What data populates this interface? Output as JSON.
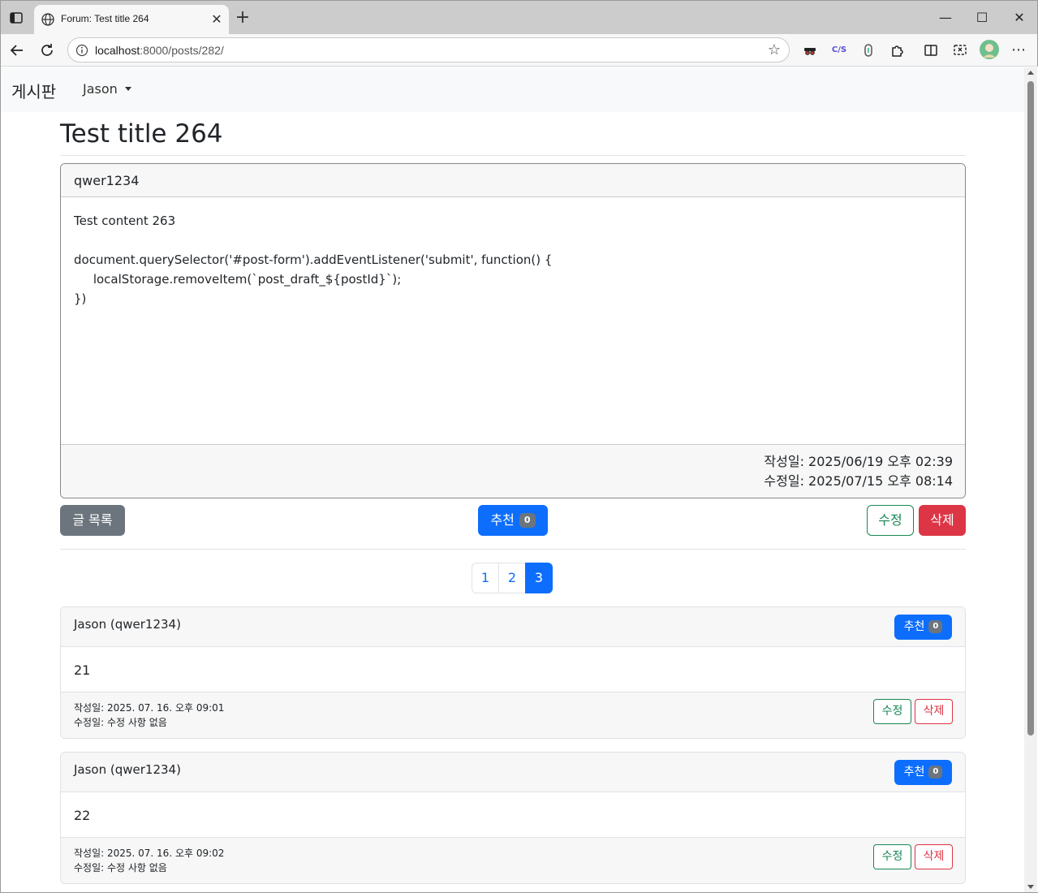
{
  "browser": {
    "tab_title": "Forum: Test title 264",
    "address_host": "localhost",
    "address_path": ":8000/posts/282/",
    "window_controls": {
      "minimize": "—",
      "maximize": "☐",
      "close": "✕"
    }
  },
  "nav": {
    "brand": "게시판",
    "user": "Jason"
  },
  "post": {
    "title": "Test title 264",
    "author": "qwer1234",
    "content": "Test content 263\n\ndocument.querySelector('#post-form').addEventListener('submit', function() {\n     localStorage.removeItem(`post_draft_${postId}`);\n})",
    "created": "작성일: 2025/06/19 오후 02:39",
    "updated": "수정일: 2025/07/15 오후 08:14"
  },
  "actions": {
    "list_label": "글 목록",
    "recommend_label": "추천",
    "recommend_count": "0",
    "edit_label": "수정",
    "delete_label": "삭제"
  },
  "pagination": {
    "pages": [
      "1",
      "2",
      "3"
    ],
    "current": "3"
  },
  "comments": [
    {
      "author": "Jason (qwer1234)",
      "recommend_label": "추천",
      "recommend_count": "0",
      "body": "21",
      "created": "작성일: 2025. 07. 16. 오후 09:01",
      "updated": "수정일: 수정 사항 없음",
      "edit_label": "수정",
      "delete_label": "삭제"
    },
    {
      "author": "Jason (qwer1234)",
      "recommend_label": "추천",
      "recommend_count": "0",
      "body": "22",
      "created": "작성일: 2025. 07. 16. 오후 09:02",
      "updated": "수정일: 수정 사항 없음",
      "edit_label": "수정",
      "delete_label": "삭제"
    }
  ],
  "colors": {
    "primary": "#0d6efd",
    "secondary": "#6c757d",
    "danger": "#dc3545",
    "success": "#198754"
  }
}
